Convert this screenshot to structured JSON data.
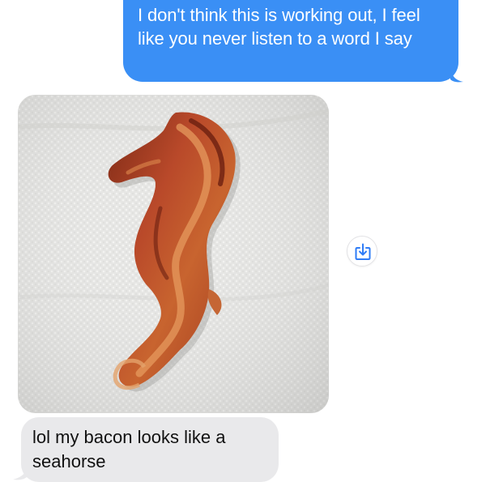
{
  "messages": {
    "sent": {
      "text": "I don't think this is working out, I feel like you never listen to a word I say"
    },
    "photo": {
      "subject_icon": "bacon-seahorse-photo"
    },
    "received": {
      "text": "lol my bacon looks like a seahorse"
    }
  },
  "actions": {
    "save_icon": "save-download-icon"
  },
  "colors": {
    "sent_bubble": "#3a8ff5",
    "received_bubble": "#e9e9eb",
    "background": "#ffffff",
    "action_icon": "#2f7cf6"
  }
}
